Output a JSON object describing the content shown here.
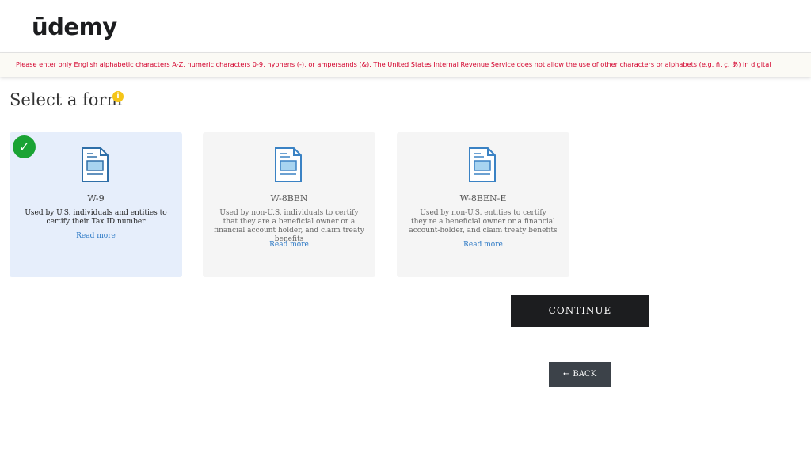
{
  "header": {
    "logo_text": "ūdemy",
    "brand_color": "#a435f0"
  },
  "warning": {
    "text": "Please enter only English alphabetic characters A-Z, numeric characters 0-9, hyphens (-), or ampersands (&). The United States Internal Revenue Service does not allow the use of other characters or alphabets (e.g. ñ, ç, あ) in digital",
    "color": "#d3002c"
  },
  "page": {
    "title": "Select a form",
    "info_icon": "info-icon"
  },
  "forms": [
    {
      "name": "W-9",
      "description": "Used by U.S. individuals and entities to certify their Tax ID number",
      "link": "Read more",
      "selected": true
    },
    {
      "name": "W-8BEN",
      "description": "Used by non-U.S. individuals to certify that they are a beneficial owner or a financial account holder, and claim treaty benefits",
      "link": "Read more",
      "selected": false
    },
    {
      "name": "W-8BEN-E",
      "description": "Used by non-U.S. entities to certify they’re a beneficial owner or a financial account-holder, and claim treaty benefits",
      "link": "Read more",
      "selected": false
    }
  ],
  "actions": {
    "continue_label": "CONTINUE",
    "back_label": "BACK",
    "back_icon": "arrow-left-icon"
  },
  "colors": {
    "selected_card": "#e6eefb",
    "check": "#1aa334",
    "link": "#2b78c5",
    "continue_bg": "#1c1d1f",
    "back_bg": "#3c4249"
  }
}
